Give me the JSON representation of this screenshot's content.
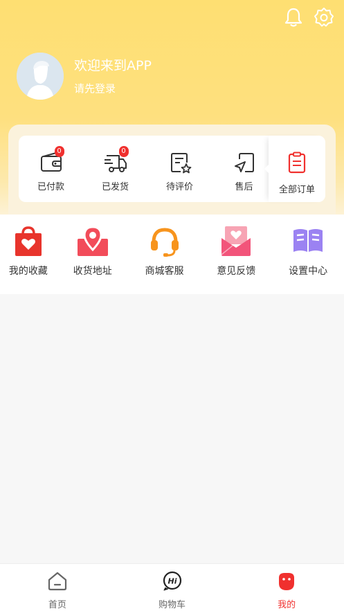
{
  "header": {
    "welcome": "欢迎来到APP",
    "login_prompt": "请先登录",
    "icons": [
      "bell-icon",
      "gear-icon"
    ]
  },
  "orders": {
    "items": [
      {
        "label": "已付款",
        "badge": "0",
        "icon": "wallet-icon"
      },
      {
        "label": "已发货",
        "badge": "0",
        "icon": "truck-icon"
      },
      {
        "label": "待评价",
        "icon": "review-icon"
      },
      {
        "label": "售后",
        "icon": "after-sale-icon"
      }
    ],
    "all_label": "全部订单",
    "all_icon": "clipboard-icon"
  },
  "services": {
    "items": [
      {
        "label": "我的收藏",
        "icon": "favorites-bag-icon",
        "color": "#e8342c"
      },
      {
        "label": "收货地址",
        "icon": "location-icon",
        "color": "#f24c5a"
      },
      {
        "label": "商城客服",
        "icon": "headset-icon",
        "color": "#f7941d"
      },
      {
        "label": "意见反馈",
        "icon": "feedback-mail-icon",
        "color": "#f2547a"
      },
      {
        "label": "设置中心",
        "icon": "book-icon",
        "color": "#9b82f2"
      }
    ]
  },
  "tabbar": {
    "home": "首页",
    "cart": "购物车",
    "mine": "我的",
    "active_color": "#f0302e"
  }
}
